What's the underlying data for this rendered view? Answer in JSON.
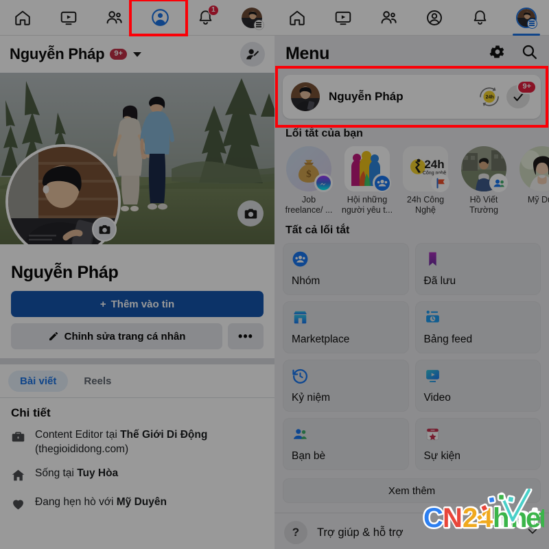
{
  "left_panel": {
    "nav": [
      {
        "name": "home-icon",
        "label": "Trang chủ",
        "active": false,
        "badge": ""
      },
      {
        "name": "video-icon",
        "label": "Video",
        "active": false,
        "badge": ""
      },
      {
        "name": "friends-icon",
        "label": "Bạn bè",
        "active": false,
        "badge": ""
      },
      {
        "name": "profile-icon",
        "label": "Trang cá nhân",
        "active": true,
        "badge": ""
      },
      {
        "name": "bell-icon",
        "label": "Thông báo",
        "active": false,
        "badge": "1"
      },
      {
        "name": "menu-avatar",
        "label": "Menu",
        "active": false,
        "badge": ""
      }
    ],
    "header": {
      "name": "Nguyễn Pháp",
      "badge": "9+",
      "add_friend_icon": "add-person-icon"
    },
    "profile": {
      "display_name": "Nguyễn Pháp",
      "add_story_button": "Thêm vào tin",
      "add_story_plus": "+",
      "edit_profile_button": "Chỉnh sửa trang cá nhân",
      "more_button": "•••",
      "cover_camera_icon": "camera-icon",
      "avatar_camera_icon": "camera-icon"
    },
    "tabs": [
      {
        "label": "Bài viết",
        "active": true
      },
      {
        "label": "Reels",
        "active": false
      }
    ],
    "details": {
      "title": "Chi tiết",
      "rows": [
        {
          "icon": "briefcase-icon",
          "prefix": "Content Editor tại ",
          "bold": "Thế Giới Di Động",
          "suffix": " (thegioididong.com)"
        },
        {
          "icon": "home-icon",
          "prefix": "Sống tại ",
          "bold": "Tuy Hòa",
          "suffix": ""
        },
        {
          "icon": "heart-icon",
          "prefix": "Đang hẹn hò với ",
          "bold": "Mỹ Duyên",
          "suffix": ""
        }
      ]
    }
  },
  "right_panel": {
    "nav": [
      {
        "name": "home-icon",
        "active": false,
        "badge": ""
      },
      {
        "name": "video-icon",
        "active": false,
        "badge": ""
      },
      {
        "name": "friends-icon",
        "active": false,
        "badge": ""
      },
      {
        "name": "profile-icon",
        "active": false,
        "badge": ""
      },
      {
        "name": "bell-icon",
        "active": false,
        "badge": ""
      },
      {
        "name": "menu-avatar",
        "active": true,
        "badge": ""
      }
    ],
    "header": {
      "title": "Menu",
      "settings_icon": "gear-icon",
      "search_icon": "search-icon"
    },
    "account_card": {
      "name": "Nguyễn Pháp",
      "avatar": "user-avatar",
      "story_ring_icon": "24h-story-ring-icon",
      "check_icon": "check-icon",
      "badge": "9+"
    },
    "shortcuts_section": {
      "title": "Lối tắt của bạn",
      "items": [
        {
          "label": "Job freelance/ ...",
          "icon": "money-bag-icon",
          "badge": "messenger-icon",
          "shape": "circ",
          "bg": "#c9d4e8"
        },
        {
          "label": "Hội những người yêu t...",
          "icon": "group-people-icon",
          "badge": "group-icon",
          "shape": "rnd",
          "bg": "#ffffff"
        },
        {
          "label": "24h Công Nghệ",
          "icon": "24h-logo-icon",
          "badge": "page-flag-icon",
          "shape": "rnd",
          "bg": "#f5f5f5"
        },
        {
          "label": "Hồ Viết Trường",
          "icon": "person-photo-icon",
          "badge": "friends-icon",
          "shape": "circ",
          "bg": "#8a8d7a"
        },
        {
          "label": "Mỹ Duy",
          "icon": "person-photo-icon",
          "badge": "",
          "shape": "circ",
          "bg": "#b7c3a8"
        }
      ]
    },
    "all_shortcuts": {
      "title": "Tất cả lối tắt",
      "items": [
        {
          "label": "Nhóm",
          "icon": "groups-icon",
          "color": "#1877f2"
        },
        {
          "label": "Đã lưu",
          "icon": "bookmark-icon",
          "color": "#9333a8"
        },
        {
          "label": "Marketplace",
          "icon": "marketplace-icon",
          "color": "#2aa3df"
        },
        {
          "label": "Bảng feed",
          "icon": "feeds-icon",
          "color": "#1d9bf0"
        },
        {
          "label": "Kỷ niệm",
          "icon": "memories-clock-icon",
          "color": "#1877f2"
        },
        {
          "label": "Video",
          "icon": "video-icon",
          "color": "#159ab8"
        },
        {
          "label": "Bạn bè",
          "icon": "friends-icon",
          "color": "#1877f2"
        },
        {
          "label": "Sự kiện",
          "icon": "events-calendar-icon",
          "color": "#c52f4d"
        }
      ],
      "see_more": "Xem thêm"
    },
    "help": {
      "label": "Trợ giúp & hỗ trợ",
      "icon": "question-mark-icon",
      "chevron": "chevron-down-icon"
    }
  },
  "annotations": {
    "highlight_color": "#fb0007",
    "boxes": [
      {
        "name": "profile-tab-highlight"
      },
      {
        "name": "menu-tab-highlight"
      },
      {
        "name": "account-card-highlight"
      }
    ]
  },
  "watermark": {
    "text": "CN24h.net",
    "parts": [
      "C",
      "N",
      "2",
      "4",
      "h",
      "n",
      "e",
      "t"
    ]
  }
}
